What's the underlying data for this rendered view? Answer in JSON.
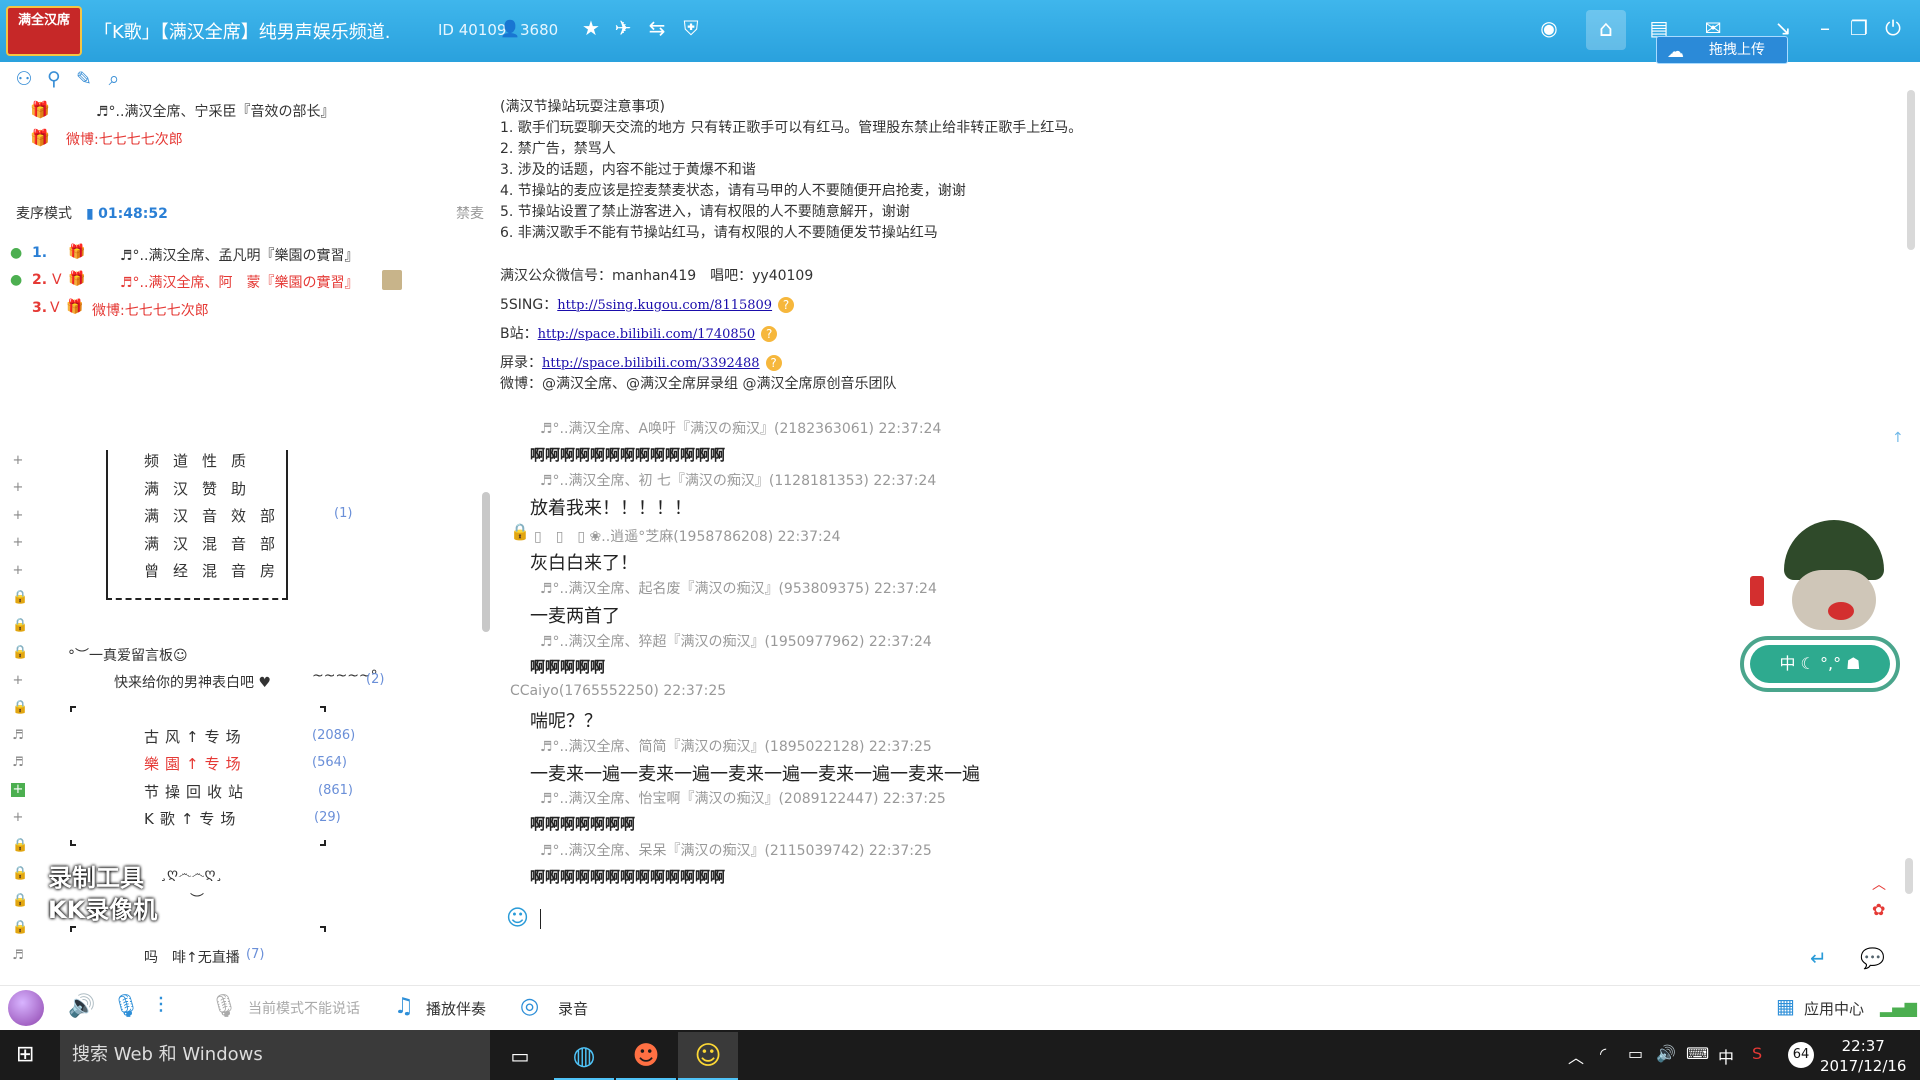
{
  "window": {
    "logo_text": "满全汉席",
    "title": "「K歌」【满汉全席】纯男声娱乐频道.",
    "room_id": "ID 40109",
    "online_count": "3680",
    "upload_label": "拖拽上传"
  },
  "left": {
    "top_users": [
      {
        "name": "♬°..满汉全席、宁采臣『音效の部长』"
      },
      {
        "name": "微博:七七七七次郎"
      }
    ],
    "mode_label": "麦序模式",
    "mode_time": "01:48:52",
    "ban_mic": "禁麦",
    "queue": [
      {
        "rank": "1.",
        "name": "♬°..满汉全席、孟凡明『樂園の實習』"
      },
      {
        "rank": "2.",
        "name": "♬°..满汉全席、阿　蒙『樂園の實習』"
      },
      {
        "rank": "3.",
        "name": "微博:七七七七次郎"
      }
    ],
    "channels_a": [
      {
        "label": "频道性质",
        "count": ""
      },
      {
        "label": "满汉赞助",
        "count": ""
      },
      {
        "label": "满汉音效部",
        "count": "(1)"
      },
      {
        "label": "满汉混音部",
        "count": ""
      },
      {
        "label": "曾经混音房",
        "count": ""
      }
    ],
    "msgboard_title": "°︶一真爱留言板☺",
    "msgboard_sub": "快来给你的男神表白吧 ♥",
    "msgboard_tilde": "~~~~~°",
    "msgboard_count": "(2)",
    "channels_b": [
      {
        "label": "古风↑专场",
        "count": "(2086)"
      },
      {
        "label": "樂園↑专场",
        "count": "(564)"
      },
      {
        "label": "节操回收站",
        "count": "(861)"
      },
      {
        "label": "K歌↑专场",
        "count": "(29)"
      }
    ],
    "decor": "¸ღ෴෴ღ¸",
    "decor2": "︶",
    "last_channel": "吗　啡↑无直播",
    "last_count": "(7)",
    "watermark_l1": "录制工具",
    "watermark_l2": "KK录像机"
  },
  "notice": {
    "lines": [
      "(满汉节操站玩耍注意事项)",
      "1. 歌手们玩耍聊天交流的地方 只有转正歌手可以有红马。管理股东禁止给非转正歌手上红马。",
      "2. 禁广告，禁骂人",
      "3. 涉及的话题，内容不能过于黄爆不和谐",
      "4. 节操站的麦应该是控麦禁麦状态，请有马甲的人不要随便开启抢麦，谢谢",
      "5. 节操站设置了禁止游客进入，请有权限的人不要随意解开，谢谢",
      "6. 非满汉歌手不能有节操站红马，请有权限的人不要随便发节操站红马"
    ],
    "wechat": "满汉公众微信号：manhan419　唱吧：yy40109",
    "links": [
      {
        "label": "5SING：",
        "url": "http://5sing.kugou.com/8115809"
      },
      {
        "label": "B站：",
        "url": "http://space.bilibili.com/1740850"
      },
      {
        "label": "屏录：",
        "url": "http://space.bilibili.com/3392488"
      }
    ],
    "weibo": "微博：@满汉全席、@满汉全席屏录组 @满汉全席原创音乐团队"
  },
  "messages": [
    {
      "header": "♬°..满汉全席、A唤吁『满汉の痴汉』(2182363061) 22:37:24",
      "body": "啊啊啊啊啊啊啊啊啊啊啊啊啊"
    },
    {
      "header": "♬°..满汉全席、初 七『满汉の痴汉』(1128181353) 22:37:24",
      "body": "放着我来！！！！！"
    },
    {
      "header": "▯　▯　▯ ❀..逍遥°芝麻(1958786208) 22:37:24",
      "body": "灰白白来了！"
    },
    {
      "header": "♬°..满汉全席、起名废『满汉の痴汉』(953809375) 22:37:24",
      "body": "一麦两首了"
    },
    {
      "header": "♬°..满汉全席、猝超『满汉の痴汉』(1950977962) 22:37:24",
      "body": "啊啊啊啊啊"
    },
    {
      "header": "CCaiyo(1765552250) 22:37:25",
      "body": "喘呢？？"
    },
    {
      "header": "♬°..满汉全席、简简『满汉の痴汉』(1895022128) 22:37:25",
      "body": "一麦来一遍一麦来一遍一麦来一遍一麦来一遍一麦来一遍"
    },
    {
      "header": "♬°..满汉全席、怡宝啊『满汉の痴汉』(2089122447) 22:37:25",
      "body": "啊啊啊啊啊啊啊"
    },
    {
      "header": "♬°..满汉全席、呆呆『满汉の痴汉』(2115039742) 22:37:25",
      "body": "啊啊啊啊啊啊啊啊啊啊啊啊啊"
    }
  ],
  "mascot": {
    "mode_text": "中 ☾ °,° ☗"
  },
  "bottom": {
    "mode_notice": "当前模式不能说话",
    "accompany": "播放伴奏",
    "record": "录音",
    "app_center": "应用中心"
  },
  "taskbar": {
    "search_placeholder": "搜索 Web 和 Windows",
    "time": "22:37",
    "date": "2017/12/16",
    "ime": "中",
    "badge": "64"
  },
  "colors": {
    "topbar": "#2aa1dd",
    "accent_red": "#e53935",
    "link": "#1a0dab"
  }
}
